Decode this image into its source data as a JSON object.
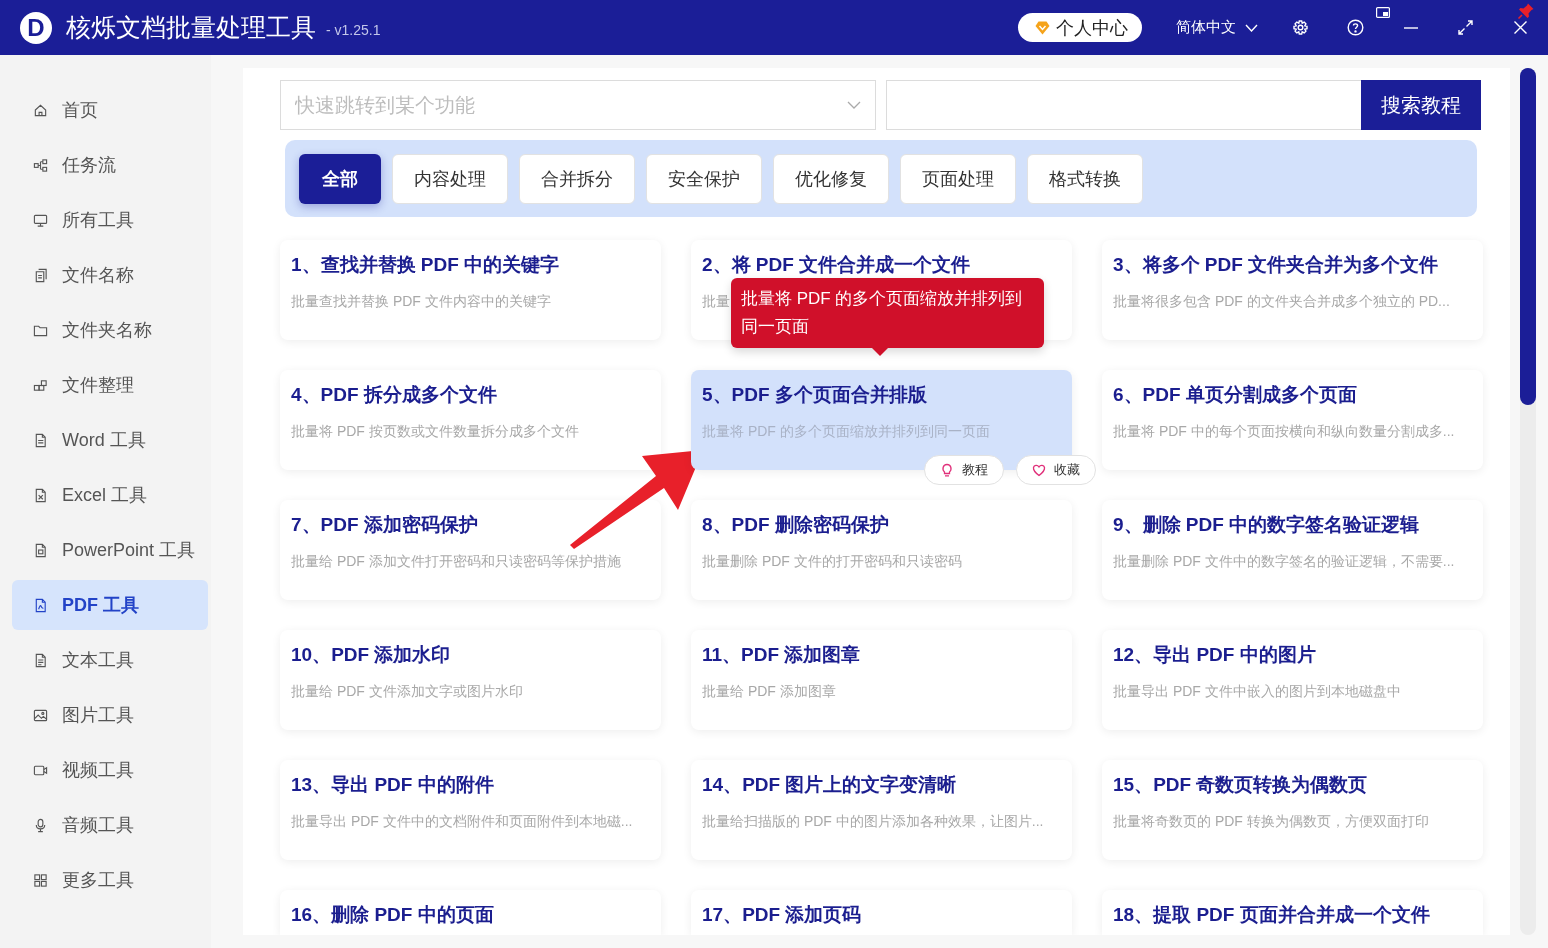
{
  "app": {
    "logo_letter": "D",
    "title": "核烁文档批量处理工具",
    "version": "- v1.25.1"
  },
  "header": {
    "account_button": "个人中心",
    "language": "简体中文"
  },
  "sidebar": {
    "items": [
      {
        "label": "首页",
        "selected": false
      },
      {
        "label": "任务流",
        "selected": false
      },
      {
        "label": "所有工具",
        "selected": false
      },
      {
        "label": "文件名称",
        "selected": false
      },
      {
        "label": "文件夹名称",
        "selected": false
      },
      {
        "label": "文件整理",
        "selected": false
      },
      {
        "label": "Word 工具",
        "selected": false
      },
      {
        "label": "Excel 工具",
        "selected": false
      },
      {
        "label": "PowerPoint 工具",
        "selected": false
      },
      {
        "label": "PDF 工具",
        "selected": true
      },
      {
        "label": "文本工具",
        "selected": false
      },
      {
        "label": "图片工具",
        "selected": false
      },
      {
        "label": "视频工具",
        "selected": false
      },
      {
        "label": "音频工具",
        "selected": false
      },
      {
        "label": "更多工具",
        "selected": false
      }
    ]
  },
  "search": {
    "placeholder": "快速跳转到某个功能",
    "button": "搜索教程"
  },
  "filters": [
    {
      "label": "全部",
      "selected": true
    },
    {
      "label": "内容处理",
      "selected": false
    },
    {
      "label": "合并拆分",
      "selected": false
    },
    {
      "label": "安全保护",
      "selected": false
    },
    {
      "label": "优化修复",
      "selected": false
    },
    {
      "label": "页面处理",
      "selected": false
    },
    {
      "label": "格式转换",
      "selected": false
    }
  ],
  "cards": [
    {
      "title": "1、查找并替换 PDF 中的关键字",
      "description": "批量查找并替换 PDF 文件内容中的关键字",
      "hovered": false
    },
    {
      "title": "2、将 PDF 文件合并成一个文件",
      "description": "批量",
      "hovered": false
    },
    {
      "title": "3、将多个 PDF 文件夹合并为多个文件",
      "description": "批量将很多包含 PDF 的文件夹合并成多个独立的 PD...",
      "hovered": false
    },
    {
      "title": "4、PDF 拆分成多个文件",
      "description": "批量将 PDF 按页数或文件数量拆分成多个文件",
      "hovered": false
    },
    {
      "title": "5、PDF 多个页面合并排版",
      "description": "批量将 PDF 的多个页面缩放并排列到同一页面",
      "hovered": true,
      "tooltip": "批量将 PDF 的多个页面缩放并排列到同一页面",
      "actions": [
        {
          "label": "教程",
          "kind": "tutorial"
        },
        {
          "label": "收藏",
          "kind": "favorite"
        }
      ]
    },
    {
      "title": "6、PDF 单页分割成多个页面",
      "description": "批量将 PDF 中的每个页面按横向和纵向数量分割成多...",
      "hovered": false
    },
    {
      "title": "7、PDF 添加密码保护",
      "description": "批量给 PDF 添加文件打开密码和只读密码等保护措施",
      "hovered": false
    },
    {
      "title": "8、PDF 删除密码保护",
      "description": "批量删除 PDF 文件的打开密码和只读密码",
      "hovered": false
    },
    {
      "title": "9、删除 PDF 中的数字签名验证逻辑",
      "description": "批量删除 PDF 文件中的数字签名的验证逻辑，不需要...",
      "hovered": false
    },
    {
      "title": "10、PDF 添加水印",
      "description": "批量给 PDF 文件添加文字或图片水印",
      "hovered": false
    },
    {
      "title": "11、PDF 添加图章",
      "description": "批量给 PDF 添加图章",
      "hovered": false
    },
    {
      "title": "12、导出 PDF 中的图片",
      "description": "批量导出 PDF 文件中嵌入的图片到本地磁盘中",
      "hovered": false
    },
    {
      "title": "13、导出 PDF 中的附件",
      "description": "批量导出 PDF 文件中的文档附件和页面附件到本地磁...",
      "hovered": false
    },
    {
      "title": "14、PDF 图片上的文字变清晰",
      "description": "批量给扫描版的 PDF 中的图片添加各种效果，让图片...",
      "hovered": false
    },
    {
      "title": "15、PDF 奇数页转换为偶数页",
      "description": "批量将奇数页的 PDF 转换为偶数页，方便双面打印",
      "hovered": false
    },
    {
      "title": "16、删除 PDF 中的页面",
      "hovered": false
    },
    {
      "title": "17、PDF 添加页码",
      "hovered": false
    },
    {
      "title": "18、提取 PDF 页面并合并成一个文件",
      "hovered": false
    }
  ]
}
